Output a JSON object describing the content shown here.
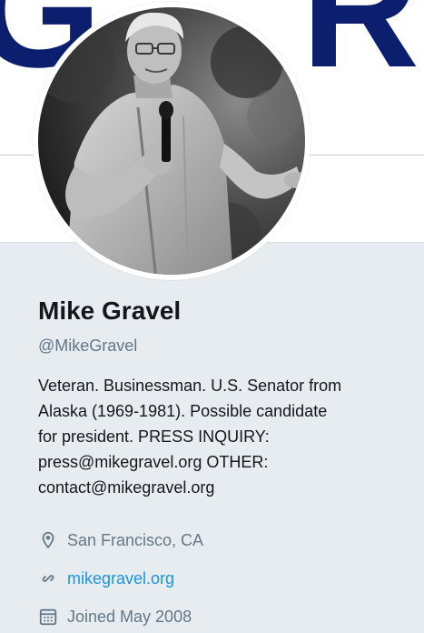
{
  "profile": {
    "name": "Mike Gravel",
    "handle": "@MikeGravel",
    "bio_lines": [
      "Veteran. Businessman. U.S. Senator from",
      "Alaska (1969-1981). Possible candidate",
      "for president. PRESS INQUIRY:",
      "press@mikegravel.org OTHER:",
      "contact@mikegravel.org"
    ],
    "location": "San Francisco, CA",
    "website": "mikegravel.org",
    "joined": "Joined May 2008"
  },
  "icons": {
    "location": "location-pin-icon",
    "website": "link-icon",
    "joined": "calendar-icon"
  },
  "colors": {
    "banner_accent": "#0b1f6e",
    "link": "#1b95e0",
    "muted": "#657786",
    "background": "#e6ecf0"
  }
}
